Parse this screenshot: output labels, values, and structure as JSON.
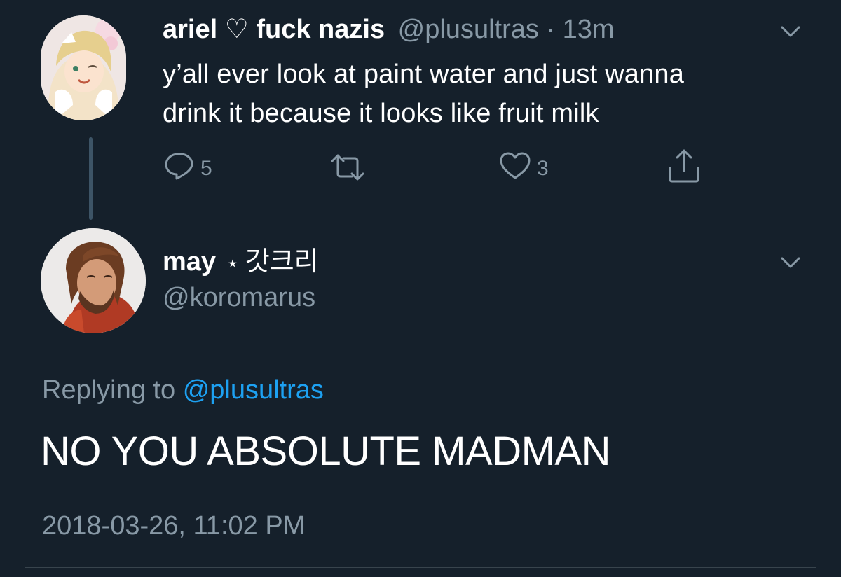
{
  "original_tweet": {
    "display_name": "ariel ♡ fuck nazis",
    "handle": "@plusultras",
    "separator": "·",
    "time_ago": "13m",
    "text_line1": "y’all ever look at paint water and just wanna",
    "text_line2": "drink it because it looks like fruit milk",
    "actions": {
      "reply_icon": "reply-icon",
      "reply_count": "5",
      "retweet_icon": "retweet-icon",
      "like_icon": "heart-icon",
      "like_count": "3",
      "share_icon": "share-icon"
    }
  },
  "reply_tweet": {
    "display_name": "may",
    "star": "⋆",
    "name_suffix": "갓크리",
    "handle": "@koromarus",
    "replying_prefix": "Replying to",
    "replying_to": "@plusultras",
    "text": "NO YOU ABSOLUTE MADMAN",
    "timestamp": "2018-03-26, 11:02 PM"
  },
  "colors": {
    "background": "#15202b",
    "text_primary": "#ffffff",
    "text_muted": "#8899a6",
    "link": "#1da1f2",
    "thread_line": "#3d5466"
  }
}
